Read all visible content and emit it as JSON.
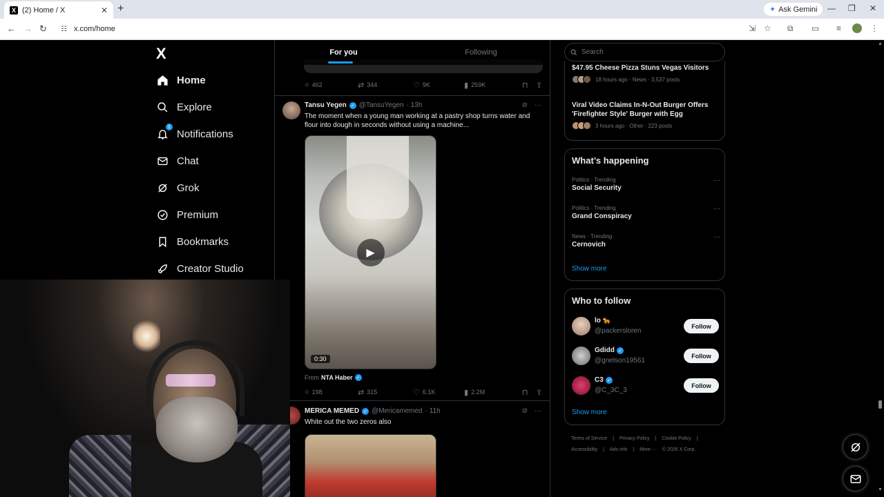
{
  "browser": {
    "tab_title": "(2) Home / X",
    "tab_favicon": "X",
    "url": "x.com/home",
    "ask_gemini": "Ask Gemini"
  },
  "nav": {
    "logo": "X",
    "items": [
      {
        "label": "Home",
        "icon": "home-icon",
        "active": true
      },
      {
        "label": "Explore",
        "icon": "search-icon"
      },
      {
        "label": "Notifications",
        "icon": "bell-icon",
        "badge": "2"
      },
      {
        "label": "Chat",
        "icon": "mail-icon"
      },
      {
        "label": "Grok",
        "icon": "grok-icon"
      },
      {
        "label": "Premium",
        "icon": "premium-icon"
      },
      {
        "label": "Bookmarks",
        "icon": "bookmark-icon"
      },
      {
        "label": "Creator Studio",
        "icon": "rocket-icon"
      }
    ]
  },
  "feed": {
    "tabs": [
      "For you",
      "Following"
    ],
    "prev_post_stats": {
      "replies": "462",
      "reposts": "344",
      "likes": "9K",
      "views": "259K"
    },
    "posts": [
      {
        "name": "Tansu Yegen",
        "handle": "@TansuYegen",
        "time": "· 13h",
        "text": "The moment when a young man working at a pastry shop turns water and flour into dough in seconds without using a machine...",
        "video_duration": "0:30",
        "from_prefix": "From",
        "from_source": "NTA Haber",
        "stats": {
          "replies": "198",
          "reposts": "315",
          "likes": "6.1K",
          "views": "2.2M"
        }
      },
      {
        "name": "MERICA MEMED",
        "handle": "@Mericamemed",
        "time": "· 11h",
        "text": "White out the two zeros also"
      }
    ]
  },
  "right": {
    "search_placeholder": "Search",
    "news": [
      {
        "title": "$47.95 Cheese Pizza Stuns Vegas Visitors",
        "meta": "18 hours ago · News · 3,537 posts"
      },
      {
        "title": "Viral Video Claims In-N-Out Burger Offers 'Firefighter Style' Burger with Egg",
        "meta": "3 hours ago · Other · 223 posts"
      }
    ],
    "happening": {
      "title": "What’s happening",
      "trends": [
        {
          "category": "Politics · Trending",
          "name": "Social Security"
        },
        {
          "category": "Politics · Trending",
          "name": "Grand Conspiracy"
        },
        {
          "category": "News · Trending",
          "name": "Cernovich"
        }
      ],
      "show_more": "Show more"
    },
    "who_to_follow": {
      "title": "Who to follow",
      "users": [
        {
          "name": "lo 🐆",
          "handle": "@packersloren",
          "verified": false
        },
        {
          "name": "Gdidd",
          "handle": "@gnelson19561",
          "verified": true
        },
        {
          "name": "C3",
          "handle": "@C_3C_3",
          "verified": true
        }
      ],
      "follow_label": "Follow",
      "show_more": "Show more"
    },
    "footer": {
      "links": [
        "Terms of Service",
        "|",
        "Privacy Policy",
        "|",
        "Cookie Policy",
        "|",
        "Accessibility",
        "|",
        "Ads info",
        "|",
        "More ···",
        "© 2026 X Corp."
      ]
    }
  },
  "colors": {
    "accent": "#1d9bf0",
    "background": "#000000",
    "border": "#2f3336",
    "muted": "#71767b"
  }
}
